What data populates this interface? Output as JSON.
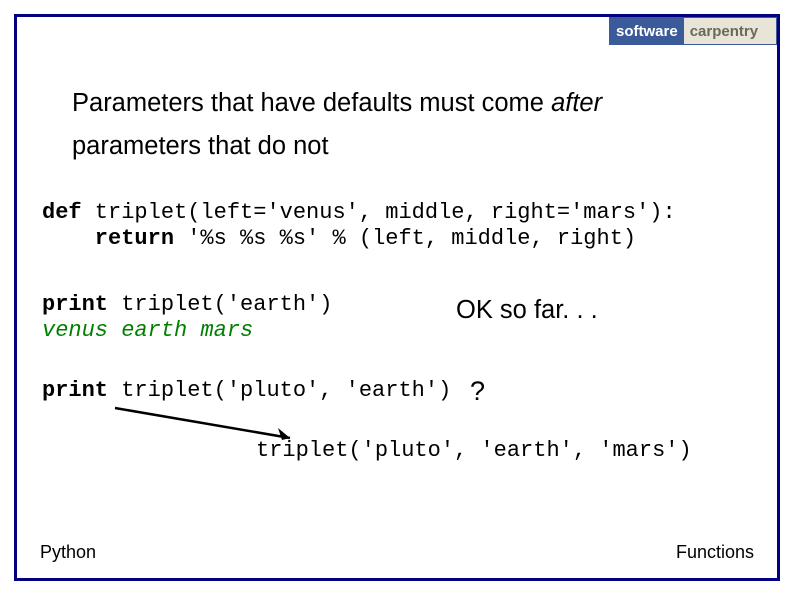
{
  "logo": {
    "left": "software",
    "right": "carpentry"
  },
  "heading": {
    "part1": "Parameters that have defaults must come ",
    "italic": "after",
    "part2": "parameters that do not"
  },
  "code": {
    "def_kw": "def",
    "def_rest": " triplet(left='venus', middle, right='mars'):",
    "return_kw": "    return",
    "return_rest": " '%s %s %s' % (left, middle, right)",
    "print1_kw": "print",
    "print1_rest": " triplet('earth')",
    "output1": "venus earth mars",
    "print2_kw": "print",
    "print2_rest": " triplet('pluto', 'earth')",
    "triplet_call": "triplet('pluto', 'earth', 'mars')"
  },
  "annotations": {
    "ok": "OK so far. . .",
    "qmark": "?"
  },
  "footer": {
    "left": "Python",
    "right": "Functions"
  }
}
